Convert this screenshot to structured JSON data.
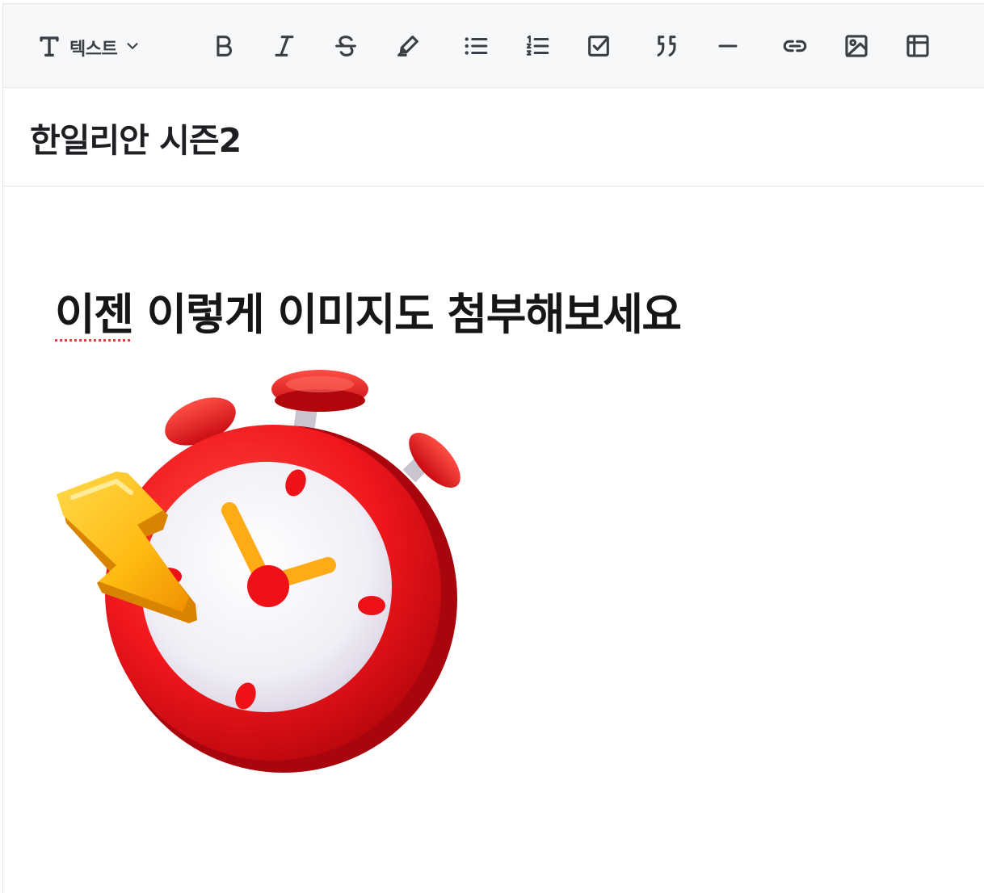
{
  "toolbar": {
    "text_style_label": "텍스트",
    "buttons": [
      {
        "name": "bold-button",
        "icon": "bold-icon"
      },
      {
        "name": "italic-button",
        "icon": "italic-icon"
      },
      {
        "name": "strikethrough-button",
        "icon": "strikethrough-icon"
      },
      {
        "name": "highlight-button",
        "icon": "highlighter-icon"
      },
      {
        "name": "bullet-list-button",
        "icon": "bullet-list-icon"
      },
      {
        "name": "numbered-list-button",
        "icon": "numbered-list-icon"
      },
      {
        "name": "checklist-button",
        "icon": "checkbox-icon"
      },
      {
        "name": "quote-button",
        "icon": "quote-icon"
      },
      {
        "name": "divider-button",
        "icon": "horizontal-rule-icon"
      },
      {
        "name": "link-button",
        "icon": "link-icon"
      },
      {
        "name": "image-button",
        "icon": "image-icon"
      },
      {
        "name": "table-button",
        "icon": "table-icon"
      }
    ]
  },
  "document": {
    "title": "한일리안 시즌2",
    "heading_first_word": "이젠",
    "heading_rest": " 이렇게 이미지도 첨부해보세요",
    "image_description_icon": "stopwatch-lightning-icon"
  },
  "colors": {
    "toolbar_bg": "#f7f8fa",
    "clock_red": "#e8141b",
    "clock_face": "#f2f0f6",
    "hand_yellow": "#ffb019",
    "bolt_yellow": "#ffc21c"
  }
}
